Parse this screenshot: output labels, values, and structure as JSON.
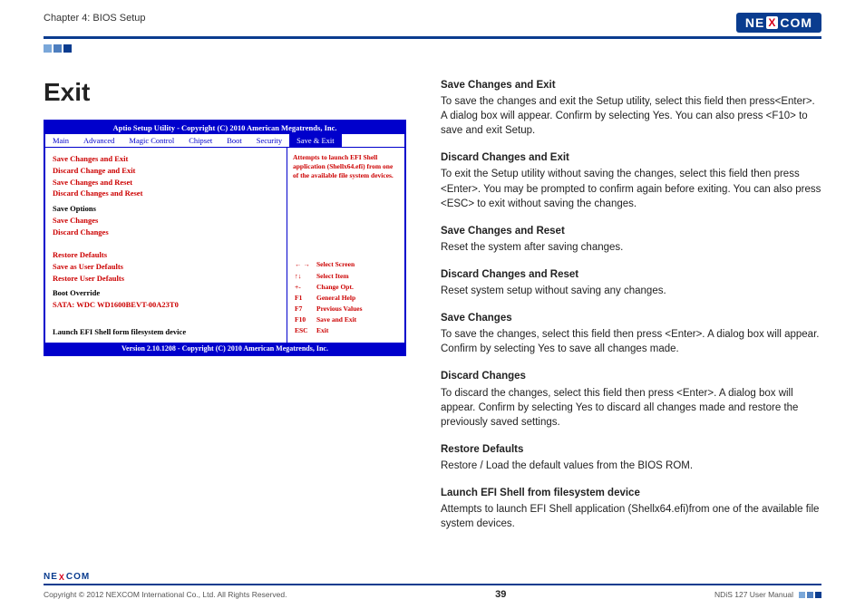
{
  "header": {
    "chapter": "Chapter 4: BIOS Setup",
    "logo_left": "NE",
    "logo_x": "X",
    "logo_right": "COM"
  },
  "title": "Exit",
  "bios": {
    "top": "Aptio  Setup  Utility - Copyright (C) 2010 American Megatrends, Inc.",
    "tabs": [
      "Main",
      "Advanced",
      "Magic Control",
      "Chipset",
      "Boot",
      "Security",
      "Save & Exit"
    ],
    "left_items_1": [
      "Save Changes and Exit",
      "Discard Change and Exit",
      "Save Changes and Reset",
      "Discard Changes and Reset"
    ],
    "save_options_label": "Save Options",
    "left_items_2": [
      "Save Changes",
      "Discard Changes"
    ],
    "left_items_3": [
      "Restore Defaults",
      "Save as User Defaults",
      "Restore User Defaults"
    ],
    "boot_override_label": "Boot Override",
    "boot_device": "SATA: WDC WD1600BEVT-00A23T0",
    "launch_efi": "Launch EFI Shell form filesystem device",
    "help_text": "Attempts to launch EFI Shell application (Shellx64.efi) from one of the available file system devices.",
    "keys": [
      [
        "← →",
        "Select Screen"
      ],
      [
        "↑↓",
        "Select Item"
      ],
      [
        "+-",
        "Change Opt."
      ],
      [
        "F1",
        "General Help"
      ],
      [
        "F7",
        "Previous Values"
      ],
      [
        "F10",
        "Save and Exit"
      ],
      [
        "ESC",
        "Exit"
      ]
    ],
    "bottom": "Version 2.10.1208 - Copyright (C) 2010 American Megatrends, Inc."
  },
  "sections": [
    {
      "hd": "Save Changes and Exit",
      "body": "To save the changes and exit the Setup utility, select this field then press<Enter>. A dialog box will appear. Confirm by selecting Yes. You can also press <F10> to save and exit Setup."
    },
    {
      "hd": "Discard Changes and Exit",
      "body": "To exit the Setup utility without saving the changes, select this field then press <Enter>. You may be prompted to confirm again before exiting. You can also press <ESC> to exit without saving the changes."
    },
    {
      "hd": "Save Changes and Reset",
      "body": "Reset the system after saving changes."
    },
    {
      "hd": "Discard Changes and Reset",
      "body": "Reset system setup without saving any changes."
    },
    {
      "hd": "Save Changes",
      "body": "To save the changes, select this field then press <Enter>. A dialog box will appear. Confirm by selecting Yes to save all changes made."
    },
    {
      "hd": "Discard Changes",
      "body": "To discard the changes, select this field then press <Enter>. A dialog box will appear. Confirm by selecting Yes to discard all changes made and restore the previously saved settings."
    },
    {
      "hd": "Restore Defaults",
      "body": "Restore / Load the default values from the BIOS ROM."
    },
    {
      "hd": "Launch EFI Shell from filesystem device",
      "body": "Attempts to launch EFI Shell application (Shellx64.efi)from one of the available file system devices."
    }
  ],
  "footer": {
    "copyright": "Copyright © 2012 NEXCOM International Co., Ltd. All Rights Reserved.",
    "page": "39",
    "manual": "NDiS 127 User Manual"
  }
}
